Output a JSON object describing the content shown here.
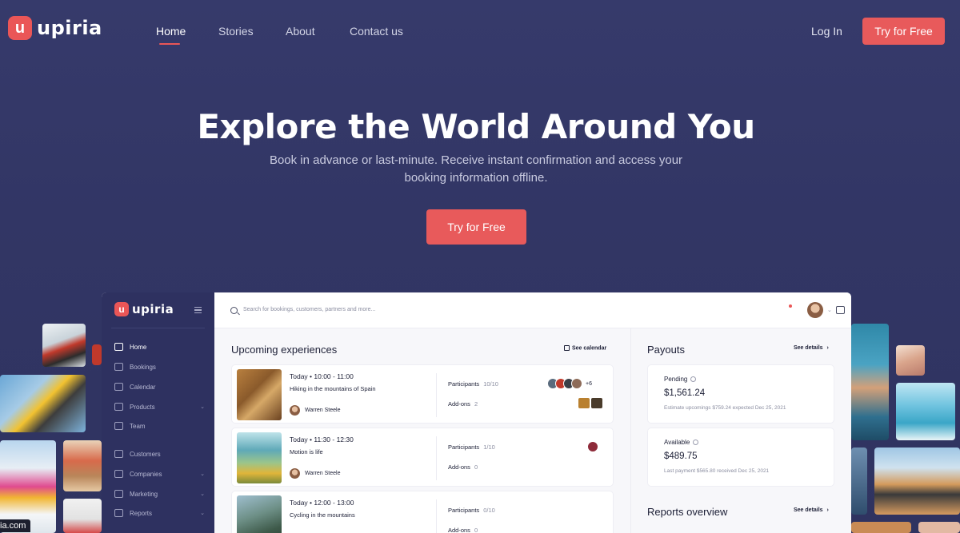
{
  "brand": {
    "name": "upiria",
    "mark": "u",
    "accent": "#e85a5b"
  },
  "nav": {
    "links": [
      {
        "label": "Home"
      },
      {
        "label": "Stories"
      },
      {
        "label": "About"
      },
      {
        "label": "Contact us"
      }
    ],
    "login": "Log In",
    "cta": "Try for Free"
  },
  "hero": {
    "title": "Explore the World Around You",
    "subtitle": "Book in advance or last-minute. Receive instant confirmation and access your booking information offline.",
    "cta": "Try for Free"
  },
  "app": {
    "sidebar": {
      "items": [
        {
          "label": "Home",
          "icon": "home-icon"
        },
        {
          "label": "Bookings",
          "icon": "bookings-icon"
        },
        {
          "label": "Calendar",
          "icon": "calendar-icon"
        },
        {
          "label": "Products",
          "icon": "products-icon"
        },
        {
          "label": "Team",
          "icon": "team-icon"
        },
        {
          "label": "Customers",
          "icon": "customers-icon"
        },
        {
          "label": "Companies",
          "icon": "companies-icon"
        },
        {
          "label": "Marketing",
          "icon": "marketing-icon"
        },
        {
          "label": "Reports",
          "icon": "reports-icon"
        }
      ]
    },
    "search": {
      "placeholder": "Search for bookings, customers, partners and more..."
    },
    "upcoming": {
      "title": "Upcoming experiences",
      "see_calendar": "See calendar",
      "items": [
        {
          "day": "Today",
          "time": "10:00 - 11:00",
          "title": "Hiking in the mountains of Spain",
          "host": "Warren Steele",
          "participants_label": "Participants",
          "participants": "10/10",
          "addons_label": "Add-ons",
          "addons": "2",
          "extra_faces": "+6"
        },
        {
          "day": "Today",
          "time": "11:30 - 12:30",
          "title": "Motion is life",
          "host": "Warren Steele",
          "participants_label": "Participants",
          "participants": "1/10",
          "addons_label": "Add-ons",
          "addons": "0"
        },
        {
          "day": "Today",
          "time": "12:00 - 13:00",
          "title": "Cycling in the mountains",
          "host": "",
          "participants_label": "Participants",
          "participants": "0/10",
          "addons_label": "Add-ons",
          "addons": "0"
        }
      ]
    },
    "payouts": {
      "title": "Payouts",
      "see_details": "See details",
      "pending": {
        "label": "Pending",
        "amount": "$1,561.24",
        "note": "Estimate upcomings $759.24 expected Dec 25, 2021"
      },
      "available": {
        "label": "Available",
        "amount": "$489.75",
        "note": "Last payment $565.80 received Dec 25, 2021"
      }
    },
    "reports": {
      "title": "Reports overview",
      "see_details": "See details"
    }
  },
  "domain_fragment": "ia.com"
}
